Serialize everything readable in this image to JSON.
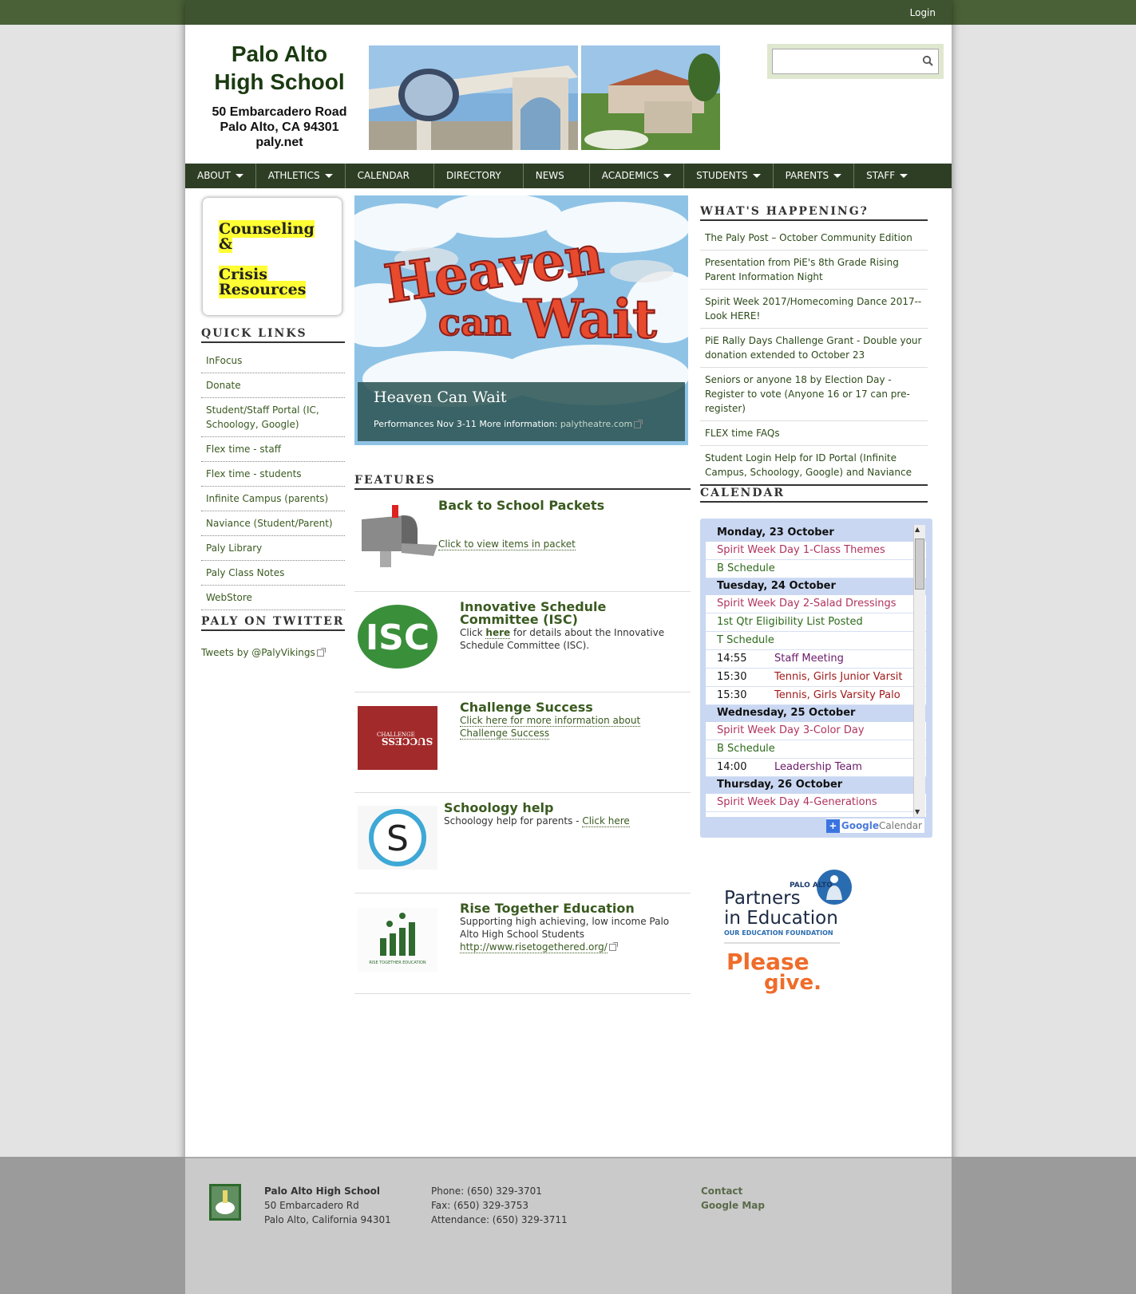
{
  "header": {
    "login": "Login",
    "school_name_line1": "Palo Alto",
    "school_name_line2": "High School",
    "address_line1": "50 Embarcadero Road",
    "address_line2": "Palo Alto, CA 94301",
    "website": "paly.net",
    "search_placeholder": ""
  },
  "nav": [
    {
      "label": "ABOUT",
      "dropdown": true
    },
    {
      "label": "ATHLETICS",
      "dropdown": true
    },
    {
      "label": "CALENDAR",
      "dropdown": false
    },
    {
      "label": "DIRECTORY",
      "dropdown": false
    },
    {
      "label": "NEWS",
      "dropdown": false
    },
    {
      "label": "ACADEMICS",
      "dropdown": true
    },
    {
      "label": "STUDENTS",
      "dropdown": true
    },
    {
      "label": "PARENTS",
      "dropdown": true
    },
    {
      "label": "STAFF",
      "dropdown": true
    }
  ],
  "crisis": {
    "line1": "Counseling",
    "line2": "&",
    "line3": "Crisis",
    "line4": "Resources"
  },
  "quick_links": {
    "title": "QUICK LINKS",
    "items": [
      "InFocus",
      "Donate",
      "Student/Staff Portal (IC, Schoology, Google)",
      "Flex time - staff",
      "Flex time - students",
      "Infinite Campus (parents)",
      "Naviance (Student/Parent)",
      "Paly Library",
      "Paly Class Notes",
      "WebStore"
    ]
  },
  "twitter": {
    "title": "PALY ON TWITTER",
    "link": "Tweets by @PalyVikings"
  },
  "hero": {
    "art_line1": "Heaven",
    "art_line2": "can",
    "art_line3": "Wait",
    "title": "Heaven Can Wait",
    "text": "Performances Nov 3-11 More information: ",
    "link": "palytheatre.com"
  },
  "features": {
    "title": "FEATURES",
    "items": [
      {
        "title": "Back to School Packets",
        "text": "",
        "link": "Click to view items in packet"
      },
      {
        "title": "Innovative Schedule Committee (ISC)",
        "text_pre": "Click ",
        "link": "here",
        "text_post": " for details about the Innovative Schedule Committee (ISC).",
        "logo": "ISC"
      },
      {
        "title": "Challenge Success",
        "link": "Click here for more information about Challenge Success",
        "logo_top": "CHALLENGE",
        "logo_bottom": "SUCCESS"
      },
      {
        "title": "Schoology help",
        "text": "Schoology help for parents - ",
        "link": "Click here",
        "logo": "S"
      },
      {
        "title": "Rise Together Education",
        "text": "Supporting high achieving, low income Palo Alto High School Students",
        "link": "http://www.risetogethered.org/",
        "logo": "RISE TOGETHER EDUCATION"
      }
    ]
  },
  "whats_happening": {
    "title": "WHAT'S HAPPENING?",
    "items": [
      "The Paly Post – October Community Edition",
      "Presentation from PiE's 8th Grade Rising Parent Information Night",
      "Spirit Week 2017/Homecoming Dance 2017-- Look HERE!",
      "PiE Rally Days Challenge Grant - Double your donation extended to October 23",
      "Seniors or anyone 18 by Election Day - Register to vote (Anyone 16 or 17 can pre-register)",
      "FLEX time FAQs",
      "Student Login Help for ID Portal (Infinite Campus, Schoology, Google) and Naviance"
    ]
  },
  "calendar": {
    "title": "CALENDAR",
    "days": [
      {
        "date": "Monday, 23 October",
        "events": [
          {
            "time": "",
            "title": "Spirit Week Day 1-Class Themes",
            "color": "#b0335e"
          },
          {
            "time": "",
            "title": "B Schedule",
            "color": "#2d6a1a"
          }
        ]
      },
      {
        "date": "Tuesday, 24 October",
        "events": [
          {
            "time": "",
            "title": "Spirit Week Day 2-Salad Dressings",
            "color": "#b0335e"
          },
          {
            "time": "",
            "title": "1st Qtr Eligibility List Posted",
            "color": "#2d6a1a"
          },
          {
            "time": "",
            "title": "T Schedule",
            "color": "#2d6a1a"
          },
          {
            "time": "14:55",
            "title": "Staff Meeting",
            "color": "#6a1a6a"
          },
          {
            "time": "15:30",
            "title": "Tennis, Girls Junior Varsit",
            "color": "#a01a1a"
          },
          {
            "time": "15:30",
            "title": "Tennis, Girls Varsity Palo",
            "color": "#a01a1a"
          }
        ]
      },
      {
        "date": "Wednesday, 25 October",
        "events": [
          {
            "time": "",
            "title": "Spirit Week Day 3-Color Day",
            "color": "#b0335e"
          },
          {
            "time": "",
            "title": "B Schedule",
            "color": "#2d6a1a"
          },
          {
            "time": "14:00",
            "title": "Leadership Team",
            "color": "#6a1a6a"
          }
        ]
      },
      {
        "date": "Thursday, 26 October",
        "events": [
          {
            "time": "",
            "title": "Spirit Week Day 4-Generations",
            "color": "#b0335e"
          }
        ]
      }
    ],
    "google_label": "Google",
    "calendar_label": "Calendar"
  },
  "pie": {
    "small": "PALO ALTO",
    "line1": "Partners",
    "line2": "in Education",
    "tag": "OUR EDUCATION FOUNDATION",
    "give1": "Please",
    "give2": "give."
  },
  "footer": {
    "name": "Palo Alto High School",
    "addr1": "50 Embarcadero Rd",
    "addr2": "Palo Alto, California 94301",
    "phone": "Phone: (650) 329-3701",
    "fax": "Fax: (650) 329-3753",
    "attendance": "Attendance: (650) 329-3711",
    "contact": "Contact",
    "map": "Google Map"
  }
}
